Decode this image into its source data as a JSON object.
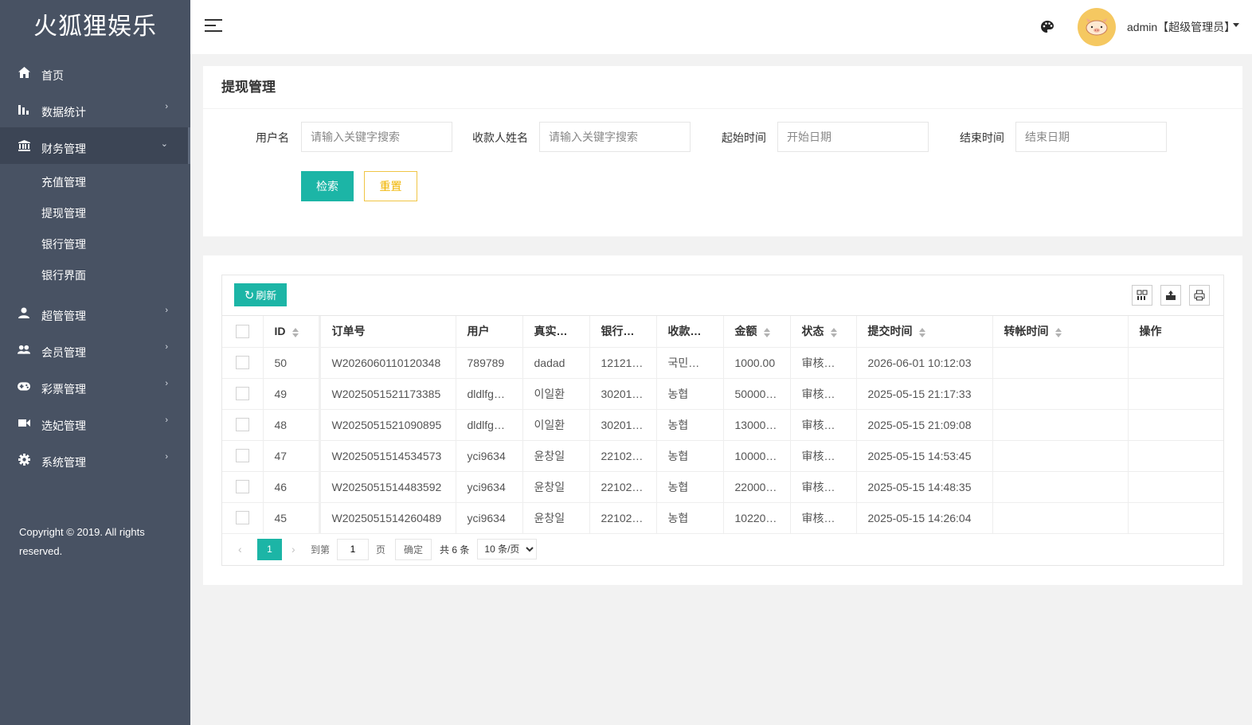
{
  "app": {
    "logo": "火狐狸娱乐",
    "copyright": "Copyright © 2019. All rights reserved."
  },
  "sidebar": {
    "items": [
      {
        "label": "首页",
        "icon": "home-icon"
      },
      {
        "label": "数据统计",
        "icon": "bar-chart-icon"
      },
      {
        "label": "财务管理",
        "icon": "bank-icon",
        "expanded": true
      },
      {
        "label": "超管管理",
        "icon": "user-icon"
      },
      {
        "label": "会员管理",
        "icon": "users-icon"
      },
      {
        "label": "彩票管理",
        "icon": "gamepad-icon"
      },
      {
        "label": "选妃管理",
        "icon": "video-icon"
      },
      {
        "label": "系统管理",
        "icon": "gear-icon"
      }
    ],
    "finance_sub": [
      "充值管理",
      "提现管理",
      "银行管理",
      "银行界面"
    ]
  },
  "header": {
    "user": "admin【超级管理员】"
  },
  "search": {
    "title": "提现管理",
    "username_label": "用户名",
    "username_placeholder": "请输入关键字搜索",
    "payee_label": "收款人姓名",
    "payee_placeholder": "请输入关键字搜索",
    "start_label": "起始时间",
    "start_placeholder": "开始日期",
    "end_label": "结束时间",
    "end_placeholder": "结束日期",
    "search_btn": "检索",
    "reset_btn": "重置"
  },
  "table": {
    "refresh_btn": "刷新",
    "headers": [
      "ID",
      "订单号",
      "用户",
      "真实…",
      "银行…",
      "收款…",
      "金额",
      "状态",
      "提交时间",
      "转帐时间",
      "操作"
    ],
    "rows": [
      {
        "id": "50",
        "order": "W2026060110120348",
        "user": "789789",
        "real": "dadad",
        "bank": "12121…",
        "payee": "국민…",
        "amount": "1000.00",
        "status": "审核通过",
        "status_type": "pass",
        "submit": "2026-06-01 10:12:03",
        "transfer": "",
        "op": ""
      },
      {
        "id": "49",
        "order": "W2025051521173385",
        "user": "dldlfg…",
        "real": "이일환",
        "bank": "30201…",
        "payee": "농협",
        "amount": "50000…",
        "status": "审核拒绝",
        "status_type": "reject",
        "submit": "2025-05-15 21:17:33",
        "transfer": "",
        "op": ""
      },
      {
        "id": "48",
        "order": "W2025051521090895",
        "user": "dldlfg…",
        "real": "이일환",
        "bank": "30201…",
        "payee": "농협",
        "amount": "13000…",
        "status": "审核通过",
        "status_type": "pass",
        "submit": "2025-05-15 21:09:08",
        "transfer": "",
        "op": ""
      },
      {
        "id": "47",
        "order": "W2025051514534573",
        "user": "yci9634",
        "real": "윤창일",
        "bank": "22102…",
        "payee": "농협",
        "amount": "10000…",
        "status": "审核拒绝",
        "status_type": "reject",
        "submit": "2025-05-15 14:53:45",
        "transfer": "",
        "op": ""
      },
      {
        "id": "46",
        "order": "W2025051514483592",
        "user": "yci9634",
        "real": "윤창일",
        "bank": "22102…",
        "payee": "농협",
        "amount": "22000…",
        "status": "审核通过",
        "status_type": "pass",
        "submit": "2025-05-15 14:48:35",
        "transfer": "",
        "op": ""
      },
      {
        "id": "45",
        "order": "W2025051514260489",
        "user": "yci9634",
        "real": "윤창일",
        "bank": "22102…",
        "payee": "농협",
        "amount": "10220…",
        "status": "审核拒绝",
        "status_type": "reject",
        "submit": "2025-05-15 14:26:04",
        "transfer": "",
        "op": ""
      }
    ]
  },
  "pager": {
    "current": "1",
    "goto_label": "到第",
    "goto_value": "1",
    "page_label": "页",
    "confirm_btn": "确定",
    "total": "共 6 条",
    "per_page": "10 条/页"
  },
  "colors": {
    "accent": "#1cb5a6",
    "sidebar": "#485263",
    "pass": "#1a8a1a",
    "reject": "#e02020",
    "reset": "#f0b400"
  }
}
